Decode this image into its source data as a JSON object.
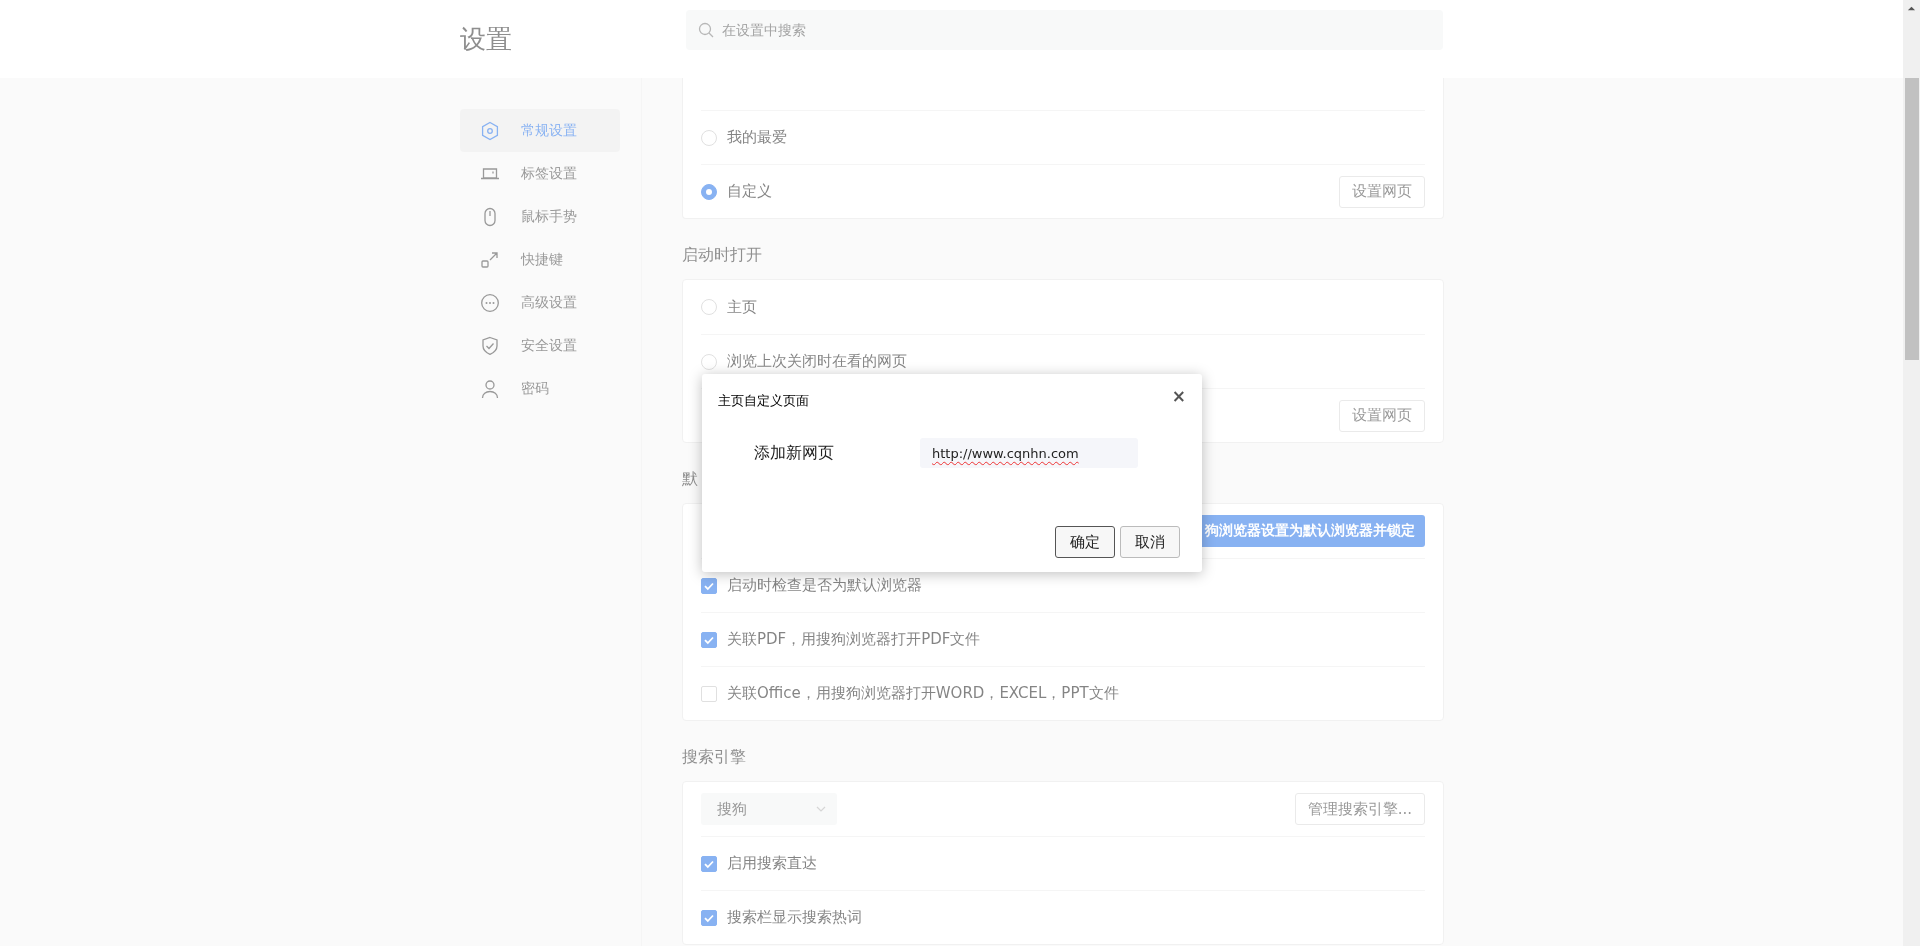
{
  "header": {
    "title": "设置",
    "search": {
      "placeholder": "在设置中搜索"
    }
  },
  "sidebar": {
    "items": [
      {
        "label": "常规设置",
        "selected": true
      },
      {
        "label": "标签设置",
        "selected": false
      },
      {
        "label": "鼠标手势",
        "selected": false
      },
      {
        "label": "快捷键",
        "selected": false
      },
      {
        "label": "高级设置",
        "selected": false
      },
      {
        "label": "安全设置",
        "selected": false
      },
      {
        "label": "密码",
        "selected": false
      }
    ]
  },
  "sections": [
    {
      "rows": [
        {
          "kind": "cut"
        },
        {
          "kind": "radio",
          "label": "我的最爱",
          "selected": false
        },
        {
          "kind": "radio",
          "label": "自定义",
          "selected": true,
          "button": "设置网页"
        }
      ]
    },
    {
      "heading": "启动时打开",
      "rows": [
        {
          "kind": "radio",
          "label": "主页",
          "selected": false
        },
        {
          "kind": "radio",
          "label": "浏览上次关闭时在看的网页",
          "selected": false
        },
        {
          "kind": "button",
          "button": "设置网页"
        }
      ]
    },
    {
      "heading": "默",
      "rows": [
        {
          "kind": "primary",
          "button": "狗浏览器设置为默认浏览器并锁定"
        },
        {
          "kind": "checkbox",
          "label": "启动时检查是否为默认浏览器",
          "checked": true
        },
        {
          "kind": "checkbox",
          "label": "关联PDF，用搜狗浏览器打开PDF文件",
          "checked": true
        },
        {
          "kind": "checkbox",
          "label": "关联Office，用搜狗浏览器打开WORD，EXCEL，PPT文件",
          "checked": false
        }
      ]
    },
    {
      "heading": "搜索引擎",
      "rows": [
        {
          "kind": "select",
          "value": "搜狗",
          "button": "管理搜索引擎..."
        },
        {
          "kind": "checkbox",
          "label": "启用搜索直达",
          "checked": true
        },
        {
          "kind": "checkbox",
          "label": "搜索栏显示搜索热词",
          "checked": true
        }
      ]
    }
  ],
  "dialog": {
    "title": "主页自定义页面",
    "close": "×",
    "label": "添加新网页",
    "url": "http://www.cqnhn.com",
    "buttons": [
      {
        "label": "确定",
        "focused": true
      },
      {
        "label": "取消",
        "focused": false
      }
    ]
  }
}
